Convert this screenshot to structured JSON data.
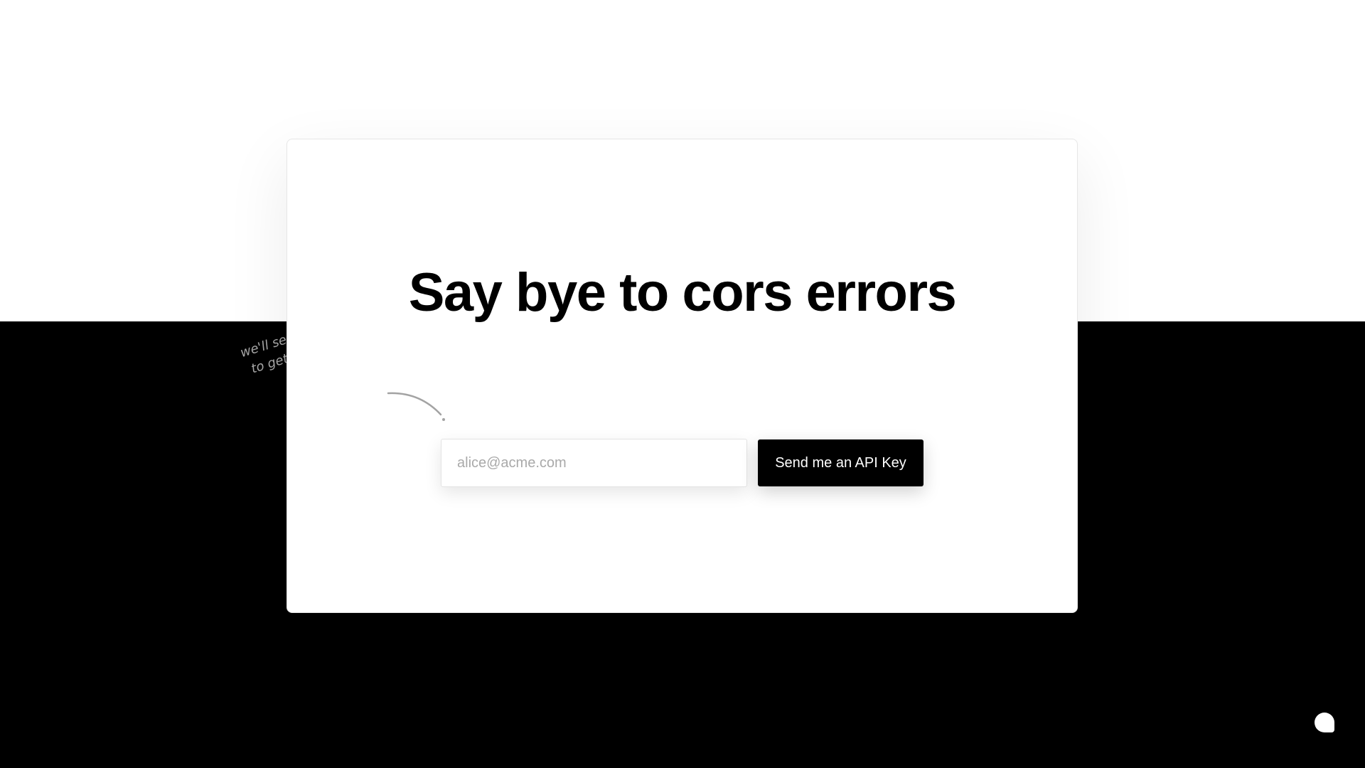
{
  "hero": {
    "headline": "Say bye to cors errors"
  },
  "signup": {
    "email_placeholder": "alice@acme.com",
    "submit_label": "Send me an API Key"
  },
  "hint": {
    "line1": "we'll send you an Api key",
    "line2": "to get started"
  },
  "icons": {
    "arrow": "curved-arrow-icon",
    "chat": "chat-bubble-icon"
  },
  "colors": {
    "background_top": "#ffffff",
    "background_bottom": "#000000",
    "button": "#000000",
    "hint_text": "#a8a8a8"
  }
}
